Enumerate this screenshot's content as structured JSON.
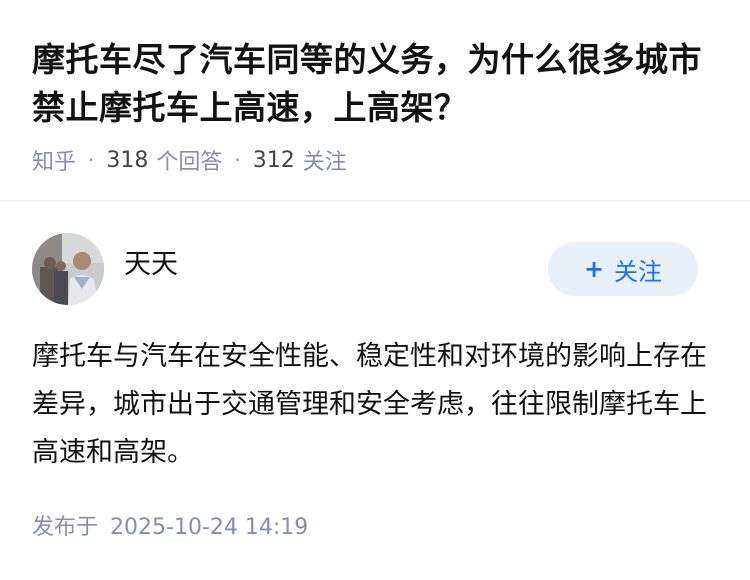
{
  "question": {
    "title": "摩托车尽了汽车同等的义务，为什么很多城市禁止摩托车上高速，上高架？",
    "source": "知乎",
    "separator": "·",
    "answer_count": "318",
    "answer_count_label": "个回答",
    "follow_count": "312",
    "follow_count_label": "关注"
  },
  "answer": {
    "author": {
      "name": "天天",
      "avatar_icon": "person-photo-avatar"
    },
    "follow_button": {
      "icon": "plus-icon",
      "icon_glyph": "+",
      "label": "关注"
    },
    "content": "摩托车与汽车在安全性能、稳定性和对环境的影响上存在差异，城市出于交通管理和安全考虑，往往限制摩托车上高速和高架。",
    "published_label": "发布于",
    "published_time": "2025-10-24 14:19"
  },
  "colors": {
    "accent": "#1772f6",
    "follow_bg": "#e8f0fa",
    "meta_text": "#8590a6",
    "title_text": "#121212"
  }
}
